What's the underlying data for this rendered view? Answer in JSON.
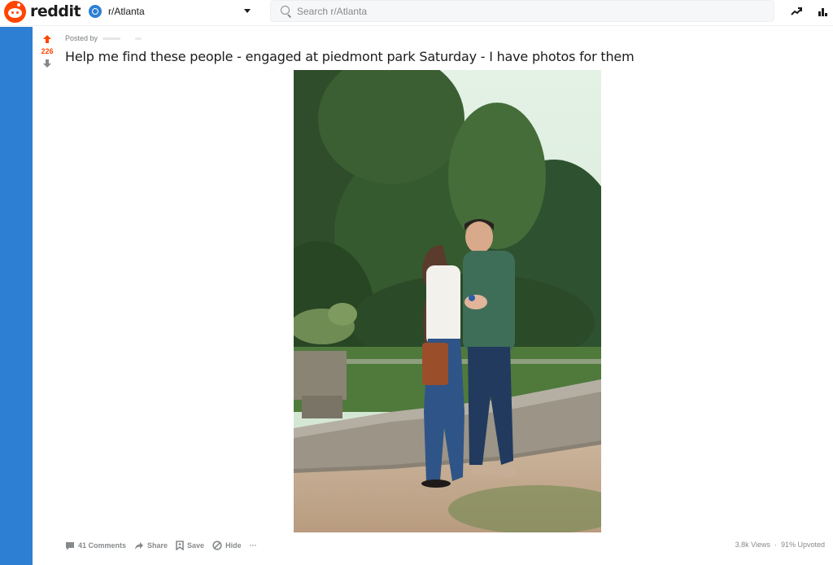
{
  "header": {
    "logo_text": "reddit",
    "community": "r/Atlanta",
    "search_placeholder": "Search r/Atlanta",
    "brand_color": "#ff4500",
    "accent_color": "#2d7fd3"
  },
  "icons": {
    "trending": "trending-up-icon",
    "chart": "bar-chart-icon"
  },
  "post": {
    "score": "226",
    "posted_by_label": "Posted by",
    "title": "Help me find these people - engaged at piedmont park Saturday - I have photos for them",
    "image_alt": "Engaged couple standing in front of a stone wall among trees at Piedmont Park"
  },
  "actions": {
    "comments": "41 Comments",
    "share": "Share",
    "save": "Save",
    "hide": "Hide",
    "more": "···"
  },
  "stats": {
    "views": "3.8k Views",
    "upvoted": "91% Upvoted"
  }
}
